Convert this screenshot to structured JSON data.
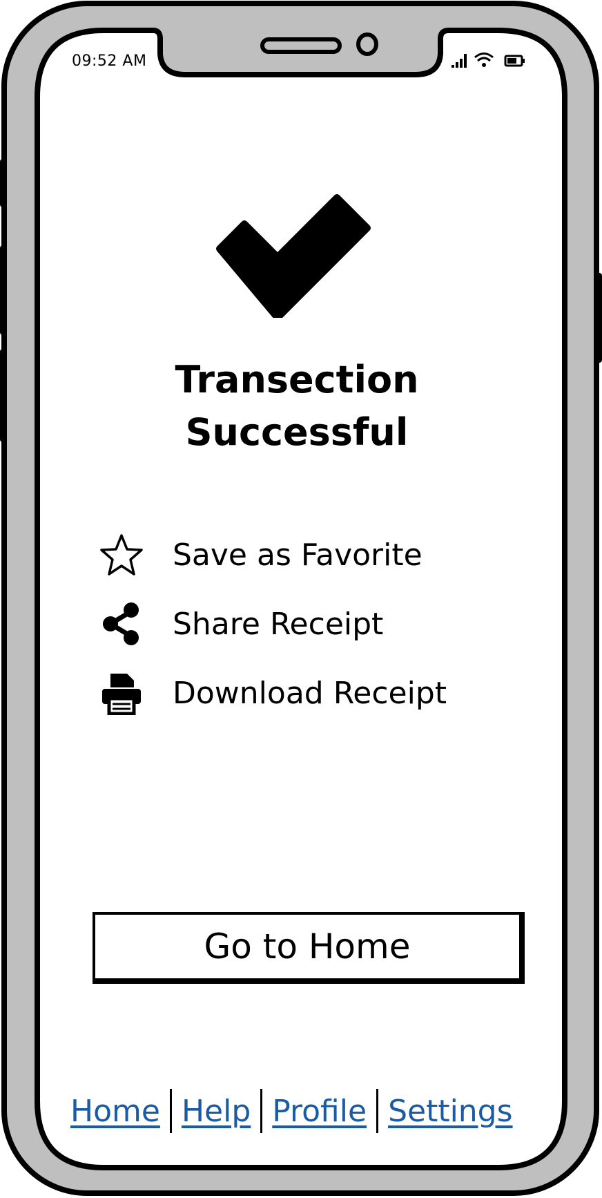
{
  "status_bar": {
    "time": "09:52 AM",
    "signal_icon": "signal-bars-icon",
    "wifi_icon": "wifi-icon",
    "battery_icon": "battery-icon"
  },
  "hero": {
    "icon": "checkmark-icon",
    "title_line1": "Transection",
    "title_line2": "Successful"
  },
  "actions": [
    {
      "icon": "star-icon",
      "label": "Save as Favorite"
    },
    {
      "icon": "share-icon",
      "label": "Share Receipt"
    },
    {
      "icon": "printer-icon",
      "label": "Download Receipt"
    }
  ],
  "primary_button": {
    "label": "Go to Home"
  },
  "bottom_nav": {
    "items": [
      {
        "label": "Home"
      },
      {
        "label": "Help"
      },
      {
        "label": "Profile"
      },
      {
        "label": "Settings"
      }
    ],
    "link_color": "#1a5ba6"
  },
  "colors": {
    "frame": "#bfbfbf",
    "outline": "#000000",
    "screen": "#ffffff"
  }
}
